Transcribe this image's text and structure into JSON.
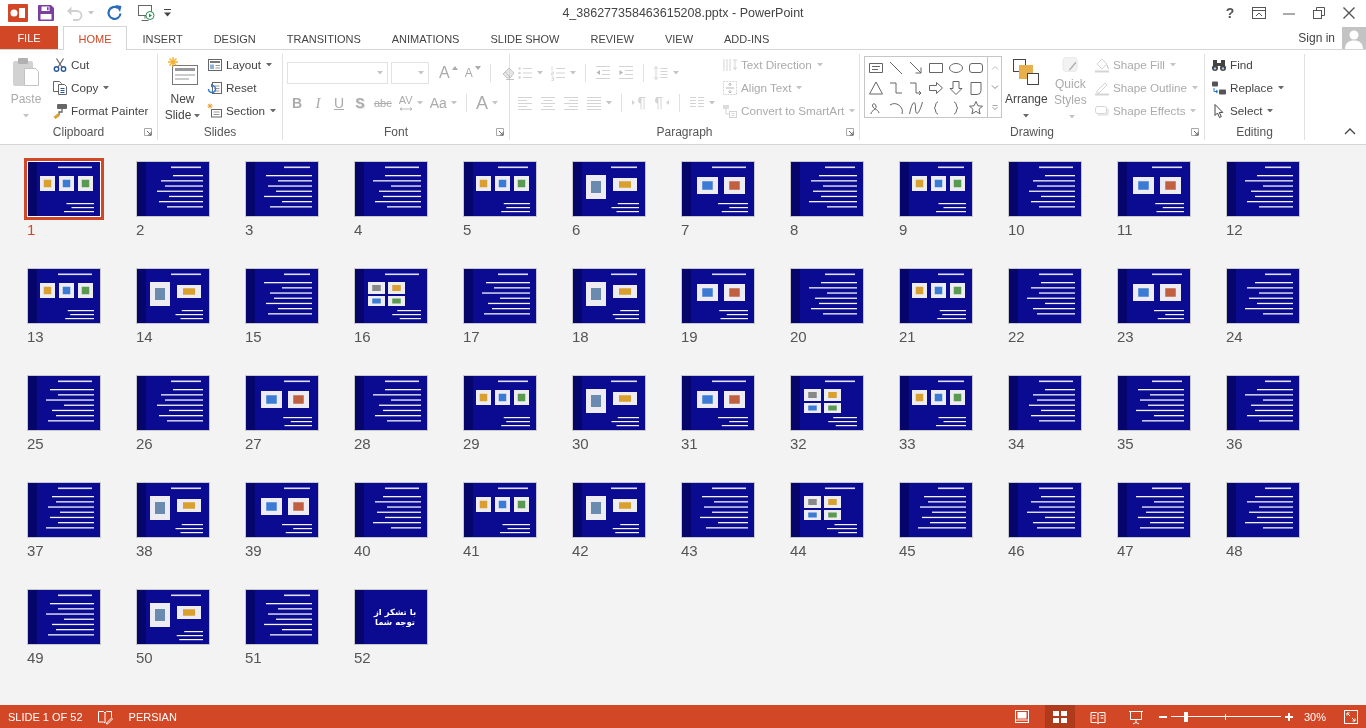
{
  "title_bar": {
    "quick_access": [
      {
        "kind": "app",
        "disabled": false
      },
      {
        "kind": "save",
        "disabled": false
      },
      {
        "kind": "undo",
        "disabled": true
      },
      {
        "kind": "repeat",
        "disabled": false
      },
      {
        "kind": "start-show",
        "disabled": false
      },
      {
        "kind": "customize",
        "disabled": false
      }
    ],
    "title": "4_386277358463615208.pptx - PowerPoint",
    "help": "?"
  },
  "tabs": [
    {
      "label": "FILE",
      "kind": "backstage",
      "selected": false
    },
    {
      "label": "HOME",
      "kind": "tab",
      "selected": true
    },
    {
      "label": "INSERT",
      "kind": "tab",
      "selected": false
    },
    {
      "label": "DESIGN",
      "kind": "tab",
      "selected": false
    },
    {
      "label": "TRANSITIONS",
      "kind": "tab",
      "selected": false
    },
    {
      "label": "ANIMATIONS",
      "kind": "tab",
      "selected": false
    },
    {
      "label": "SLIDE SHOW",
      "kind": "tab",
      "selected": false
    },
    {
      "label": "REVIEW",
      "kind": "tab",
      "selected": false
    },
    {
      "label": "VIEW",
      "kind": "tab",
      "selected": false
    },
    {
      "label": "ADD-INS",
      "kind": "tab",
      "selected": false
    }
  ],
  "account": {
    "label": "Sign in"
  },
  "ribbon": {
    "groups": [
      {
        "label": "Clipboard",
        "launcher": true,
        "parts": [
          {
            "kind": "large",
            "commands": [
              {
                "kind": "paste",
                "label": "Paste",
                "dropdown": true,
                "disabled": true
              }
            ]
          },
          {
            "kind": "stack",
            "commands": [
              {
                "kind": "cut",
                "label": "Cut",
                "dropdown": false,
                "disabled": false
              },
              {
                "kind": "copy",
                "label": "Copy",
                "dropdown": true,
                "disabled": false
              },
              {
                "kind": "format-painter",
                "label": "Format Painter",
                "dropdown": false,
                "disabled": false
              }
            ]
          }
        ]
      },
      {
        "label": "Slides",
        "launcher": false,
        "parts": [
          {
            "kind": "large",
            "commands": [
              {
                "kind": "new-slide",
                "label": "New Slide",
                "dropdown": true,
                "disabled": false
              }
            ]
          },
          {
            "kind": "stack",
            "commands": [
              {
                "kind": "layout",
                "label": "Layout",
                "dropdown": true,
                "disabled": false
              },
              {
                "kind": "reset",
                "label": "Reset",
                "dropdown": false,
                "disabled": false
              },
              {
                "kind": "section",
                "label": "Section",
                "dropdown": true,
                "disabled": false
              }
            ]
          }
        ]
      },
      {
        "label": "Font",
        "launcher": true,
        "parts": [
          {
            "kind": "rows",
            "rows": [
              {
                "controls": [
                  {
                    "kind": "font-name",
                    "dropdown": true,
                    "disabled": true
                  },
                  {
                    "kind": "font-size",
                    "dropdown": true,
                    "disabled": true
                  },
                  {
                    "kind": "grow-font",
                    "label": "A",
                    "dropdown": false,
                    "disabled": true
                  },
                  {
                    "kind": "shrink-font",
                    "label": "A",
                    "dropdown": false,
                    "disabled": true
                  },
                  {
                    "kind": "separator"
                  },
                  {
                    "kind": "clear-formatting",
                    "dropdown": false,
                    "disabled": true
                  }
                ]
              },
              {
                "controls": [
                  {
                    "kind": "bold",
                    "label": "B",
                    "dropdown": false,
                    "disabled": true
                  },
                  {
                    "kind": "italic",
                    "label": "I",
                    "dropdown": false,
                    "disabled": true
                  },
                  {
                    "kind": "underline",
                    "label": "U",
                    "dropdown": false,
                    "disabled": true
                  },
                  {
                    "kind": "text-shadow",
                    "label": "S",
                    "dropdown": false,
                    "disabled": true
                  },
                  {
                    "kind": "strikethrough",
                    "label": "abc",
                    "dropdown": false,
                    "disabled": true
                  },
                  {
                    "kind": "character-spacing",
                    "label": "AV",
                    "dropdown": true,
                    "disabled": true
                  },
                  {
                    "kind": "change-case",
                    "label": "Aa",
                    "dropdown": true,
                    "disabled": true
                  },
                  {
                    "kind": "separator"
                  },
                  {
                    "kind": "font-color",
                    "label": "A",
                    "dropdown": true,
                    "disabled": true
                  }
                ]
              }
            ]
          }
        ]
      },
      {
        "label": "Paragraph",
        "launcher": true,
        "parts": [
          {
            "kind": "rows",
            "rows": [
              {
                "controls": [
                  {
                    "kind": "bullets",
                    "dropdown": true,
                    "disabled": true
                  },
                  {
                    "kind": "numbering",
                    "dropdown": true,
                    "disabled": true
                  },
                  {
                    "kind": "separator"
                  },
                  {
                    "kind": "decrease-indent",
                    "dropdown": false,
                    "disabled": true
                  },
                  {
                    "kind": "increase-indent",
                    "dropdown": false,
                    "disabled": true
                  },
                  {
                    "kind": "separator"
                  },
                  {
                    "kind": "line-spacing",
                    "dropdown": true,
                    "disabled": true
                  }
                ]
              },
              {
                "controls": [
                  {
                    "kind": "align-left",
                    "dropdown": false,
                    "disabled": true
                  },
                  {
                    "kind": "center",
                    "dropdown": false,
                    "disabled": true
                  },
                  {
                    "kind": "align-right",
                    "dropdown": false,
                    "disabled": true
                  },
                  {
                    "kind": "justify",
                    "dropdown": true,
                    "disabled": true
                  },
                  {
                    "kind": "separator"
                  },
                  {
                    "kind": "left-to-right",
                    "dropdown": false,
                    "disabled": true
                  },
                  {
                    "kind": "right-to-left",
                    "dropdown": false,
                    "disabled": true
                  },
                  {
                    "kind": "separator"
                  },
                  {
                    "kind": "columns",
                    "dropdown": true,
                    "disabled": true
                  }
                ]
              }
            ]
          },
          {
            "kind": "stack",
            "commands": [
              {
                "kind": "text-direction",
                "label": "Text Direction",
                "dropdown": true,
                "disabled": true
              },
              {
                "kind": "align-text",
                "label": "Align Text",
                "dropdown": true,
                "disabled": true
              },
              {
                "kind": "convert-to-smartart",
                "label": "Convert to SmartArt",
                "dropdown": true,
                "disabled": true
              }
            ]
          }
        ]
      },
      {
        "label": "Drawing",
        "launcher": true,
        "parts": [
          {
            "kind": "gallery"
          },
          {
            "kind": "large",
            "commands": [
              {
                "kind": "arrange",
                "label": "Arrange",
                "dropdown": true,
                "disabled": false
              }
            ]
          },
          {
            "kind": "large",
            "commands": [
              {
                "kind": "quick-styles",
                "label": "Quick Styles",
                "dropdown": true,
                "disabled": true
              }
            ]
          },
          {
            "kind": "stack",
            "commands": [
              {
                "kind": "shape-fill",
                "label": "Shape Fill",
                "dropdown": true,
                "disabled": true
              },
              {
                "kind": "shape-outline",
                "label": "Shape Outline",
                "dropdown": true,
                "disabled": true
              },
              {
                "kind": "shape-effects",
                "label": "Shape Effects",
                "dropdown": true,
                "disabled": true
              }
            ]
          }
        ]
      },
      {
        "label": "Editing",
        "launcher": false,
        "parts": [
          {
            "kind": "stack",
            "commands": [
              {
                "kind": "find",
                "label": "Find",
                "dropdown": false,
                "disabled": false
              },
              {
                "kind": "replace",
                "label": "Replace",
                "dropdown": true,
                "disabled": false
              },
              {
                "kind": "select",
                "label": "Select",
                "dropdown": true,
                "disabled": false
              }
            ]
          }
        ]
      }
    ]
  },
  "slides": [
    {
      "number": "1",
      "kind": "pictures",
      "selected": true
    },
    {
      "number": "2",
      "kind": "text",
      "selected": false
    },
    {
      "number": "3",
      "kind": "text",
      "selected": false
    },
    {
      "number": "4",
      "kind": "text",
      "selected": false
    },
    {
      "number": "5",
      "kind": "pictures",
      "selected": false
    },
    {
      "number": "6",
      "kind": "pictures",
      "selected": false
    },
    {
      "number": "7",
      "kind": "pictures",
      "selected": false
    },
    {
      "number": "8",
      "kind": "text",
      "selected": false
    },
    {
      "number": "9",
      "kind": "pictures",
      "selected": false
    },
    {
      "number": "10",
      "kind": "text",
      "selected": false
    },
    {
      "number": "11",
      "kind": "pictures",
      "selected": false
    },
    {
      "number": "12",
      "kind": "text",
      "selected": false
    },
    {
      "number": "13",
      "kind": "pictures",
      "selected": false
    },
    {
      "number": "14",
      "kind": "pictures",
      "selected": false
    },
    {
      "number": "15",
      "kind": "text",
      "selected": false
    },
    {
      "number": "16",
      "kind": "pictures",
      "selected": false
    },
    {
      "number": "17",
      "kind": "text",
      "selected": false
    },
    {
      "number": "18",
      "kind": "pictures",
      "selected": false
    },
    {
      "number": "19",
      "kind": "pictures",
      "selected": false
    },
    {
      "number": "20",
      "kind": "text",
      "selected": false
    },
    {
      "number": "21",
      "kind": "pictures",
      "selected": false
    },
    {
      "number": "22",
      "kind": "text",
      "selected": false
    },
    {
      "number": "23",
      "kind": "pictures",
      "selected": false
    },
    {
      "number": "24",
      "kind": "text",
      "selected": false
    },
    {
      "number": "25",
      "kind": "text",
      "selected": false
    },
    {
      "number": "26",
      "kind": "text",
      "selected": false
    },
    {
      "number": "27",
      "kind": "pictures",
      "selected": false
    },
    {
      "number": "28",
      "kind": "text",
      "selected": false
    },
    {
      "number": "29",
      "kind": "pictures",
      "selected": false
    },
    {
      "number": "30",
      "kind": "pictures",
      "selected": false
    },
    {
      "number": "31",
      "kind": "pictures",
      "selected": false
    },
    {
      "number": "32",
      "kind": "pictures",
      "selected": false
    },
    {
      "number": "33",
      "kind": "pictures",
      "selected": false
    },
    {
      "number": "34",
      "kind": "text",
      "selected": false
    },
    {
      "number": "35",
      "kind": "text",
      "selected": false
    },
    {
      "number": "36",
      "kind": "text",
      "selected": false
    },
    {
      "number": "37",
      "kind": "text",
      "selected": false
    },
    {
      "number": "38",
      "kind": "pictures",
      "selected": false
    },
    {
      "number": "39",
      "kind": "pictures",
      "selected": false
    },
    {
      "number": "40",
      "kind": "text",
      "selected": false
    },
    {
      "number": "41",
      "kind": "pictures",
      "selected": false
    },
    {
      "number": "42",
      "kind": "pictures",
      "selected": false
    },
    {
      "number": "43",
      "kind": "text",
      "selected": false
    },
    {
      "number": "44",
      "kind": "pictures",
      "selected": false
    },
    {
      "number": "45",
      "kind": "text",
      "selected": false
    },
    {
      "number": "46",
      "kind": "text",
      "selected": false
    },
    {
      "number": "47",
      "kind": "text",
      "selected": false
    },
    {
      "number": "48",
      "kind": "text",
      "selected": false
    },
    {
      "number": "49",
      "kind": "text",
      "selected": false
    },
    {
      "number": "50",
      "kind": "pictures",
      "selected": false
    },
    {
      "number": "51",
      "kind": "text",
      "selected": false
    },
    {
      "number": "52",
      "kind": "closing",
      "title": "با تشکر از توجه شما",
      "selected": false
    }
  ],
  "status_bar": {
    "slide_position": "SLIDE 1 OF 52",
    "language": "PERSIAN",
    "views": [
      {
        "kind": "normal",
        "selected": false
      },
      {
        "kind": "sorter",
        "selected": true
      },
      {
        "kind": "reading",
        "selected": false
      },
      {
        "kind": "slideshow",
        "selected": false
      }
    ],
    "zoom": {
      "level": 0.14,
      "label": "30%"
    }
  }
}
